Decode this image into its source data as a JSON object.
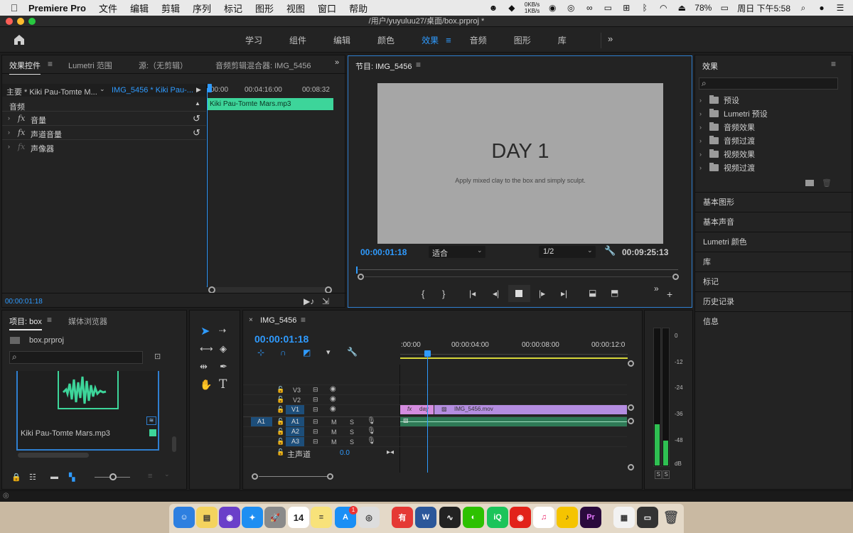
{
  "menubar": {
    "app": "Premiere Pro",
    "items": [
      "文件",
      "编辑",
      "剪辑",
      "序列",
      "标记",
      "图形",
      "视图",
      "窗口",
      "帮助"
    ],
    "net_up": "0KB/s",
    "net_down": "1KB/s",
    "battery": "78%",
    "clock": "周日 下午5:58"
  },
  "window": {
    "title": "/用户/yuyuluu27/桌面/box.prproj *"
  },
  "workspaces": {
    "tabs": [
      "学习",
      "组件",
      "编辑",
      "颜色",
      "效果",
      "音频",
      "图形",
      "库"
    ],
    "active": "效果",
    "more": "»"
  },
  "effect_controls": {
    "tabs": [
      "效果控件",
      "Lumetri 范围",
      "源:（无剪辑）",
      "音频剪辑混合器: IMG_5456"
    ],
    "master": "主要 * Kiki Pau-Tomte M...",
    "sequence": "IMG_5456 * Kiki Pau-...",
    "ruler": [
      "00:00",
      "00:04:16:00",
      "00:08:32"
    ],
    "section": "音频",
    "props": [
      {
        "fx": "fx",
        "name": "音量"
      },
      {
        "fx": "fx",
        "name": "声道音量"
      },
      {
        "fx": "fx",
        "name": "声像器"
      }
    ],
    "clip_label": "Kiki Pau-Tomte Mars.mp3",
    "timecode": "00:00:01:18"
  },
  "program": {
    "title": "节目: IMG_5456",
    "frame_title": "DAY 1",
    "frame_sub": "Apply mixed clay to the box and simply sculpt.",
    "timecode": "00:00:01:18",
    "fit": "适合",
    "resolution": "1/2",
    "duration": "00:09:25:13"
  },
  "effects": {
    "title": "效果",
    "search_placeholder": "",
    "tree": [
      "预设",
      "Lumetri 预设",
      "音频效果",
      "音频过渡",
      "视频效果",
      "视频过渡"
    ],
    "sections": [
      "基本图形",
      "基本声音",
      "Lumetri 颜色",
      "库",
      "标记",
      "历史记录",
      "信息"
    ]
  },
  "project": {
    "tabs": [
      "项目: box",
      "媒体浏览器"
    ],
    "file": "box.prproj",
    "clip_name": "Kiki Pau-Tomte Mars.mp3"
  },
  "timeline": {
    "tab": "IMG_5456",
    "timecode": "00:00:01:18",
    "ruler": [
      ":00:00",
      "00:00:04:00",
      "00:00:08:00",
      "00:00:12:0"
    ],
    "video_tracks": [
      "V3",
      "V2",
      "V1"
    ],
    "audio_tracks": [
      "A1",
      "A2",
      "A3"
    ],
    "source_patch": "A1",
    "master_label": "主声道",
    "master_value": "0.0",
    "clip_v1_fx": "day",
    "clip_v1": "IMG_5456.mov",
    "m_label": "M",
    "s_label": "S"
  },
  "meter": {
    "scale": [
      "0",
      "-12",
      "-24",
      "-36",
      "-48",
      "dB"
    ],
    "solo": [
      "S",
      "S"
    ]
  },
  "dock": {
    "calendar_day": "14",
    "appstore_badge": "1"
  }
}
